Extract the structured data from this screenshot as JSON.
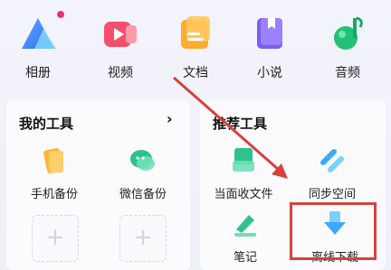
{
  "apps": [
    {
      "label": "相册",
      "icon": "album-icon"
    },
    {
      "label": "视频",
      "icon": "video-icon"
    },
    {
      "label": "文档",
      "icon": "document-icon"
    },
    {
      "label": "小说",
      "icon": "novel-icon"
    },
    {
      "label": "音频",
      "icon": "audio-icon"
    }
  ],
  "my_tools": {
    "title": "我的工具",
    "more": "›",
    "items": [
      {
        "label": "手机备份",
        "icon": "phone-backup-icon"
      },
      {
        "label": "微信备份",
        "icon": "wechat-backup-icon"
      }
    ],
    "add_symbol": "+"
  },
  "recommended_tools": {
    "title": "推荐工具",
    "items": [
      {
        "label": "当面收文件",
        "icon": "face-to-face-receive-icon"
      },
      {
        "label": "同步空间",
        "icon": "sync-space-icon"
      },
      {
        "label": "笔记",
        "icon": "notes-icon"
      },
      {
        "label": "离线下载",
        "icon": "offline-download-icon"
      }
    ]
  },
  "colors": {
    "annotation_red": "#d7413c",
    "notification_dot": "#f0306a"
  }
}
